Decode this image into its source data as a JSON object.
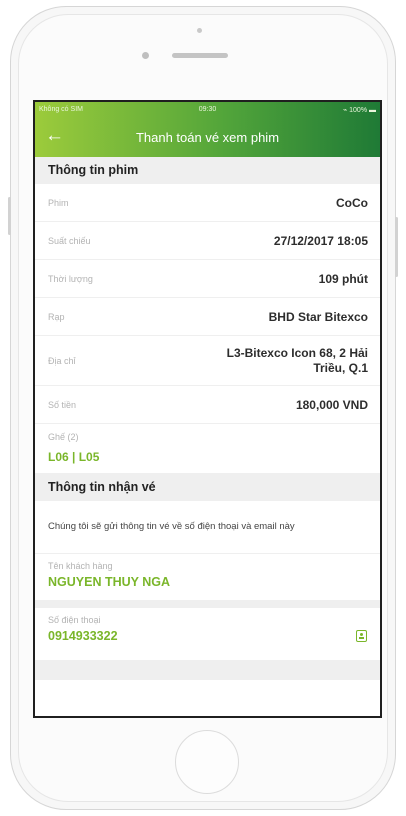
{
  "status_bar": {
    "carrier": "Không có SIM",
    "time": "09:30",
    "battery": "100%"
  },
  "header": {
    "title": "Thanh toán vé xem phim"
  },
  "movie_section": {
    "title": "Thông tin phim",
    "rows": [
      {
        "label": "Phim",
        "value": "CoCo"
      },
      {
        "label": "Suất chiếu",
        "value": "27/12/2017 18:05"
      },
      {
        "label": "Thời lượng",
        "value": "109 phút"
      },
      {
        "label": "Rạp",
        "value": "BHD Star Bitexco"
      },
      {
        "label": "Địa chỉ",
        "value_line1": "L3-Bitexco Icon 68, 2 Hải",
        "value_line2": "Triều, Q.1"
      },
      {
        "label": "Số tiền",
        "value": "180,000 VND"
      }
    ],
    "seats": {
      "label": "Ghế (2)",
      "value": "L06 | L05"
    }
  },
  "receive_section": {
    "title": "Thông tin nhận vé",
    "note": "Chúng tôi sẽ gửi thông tin vé về số điện thoại và email này",
    "customer": {
      "label": "Tên khách hàng",
      "value": "NGUYEN THUY NGA"
    },
    "phone": {
      "label": "Số điện thoại",
      "value": "0914933322"
    }
  },
  "colors": {
    "accent": "#7ab62a",
    "header_start": "#9ccb3b",
    "header_end": "#1f7a36"
  },
  "icons": {
    "back": "back-arrow-icon",
    "contact": "contact-book-icon"
  }
}
